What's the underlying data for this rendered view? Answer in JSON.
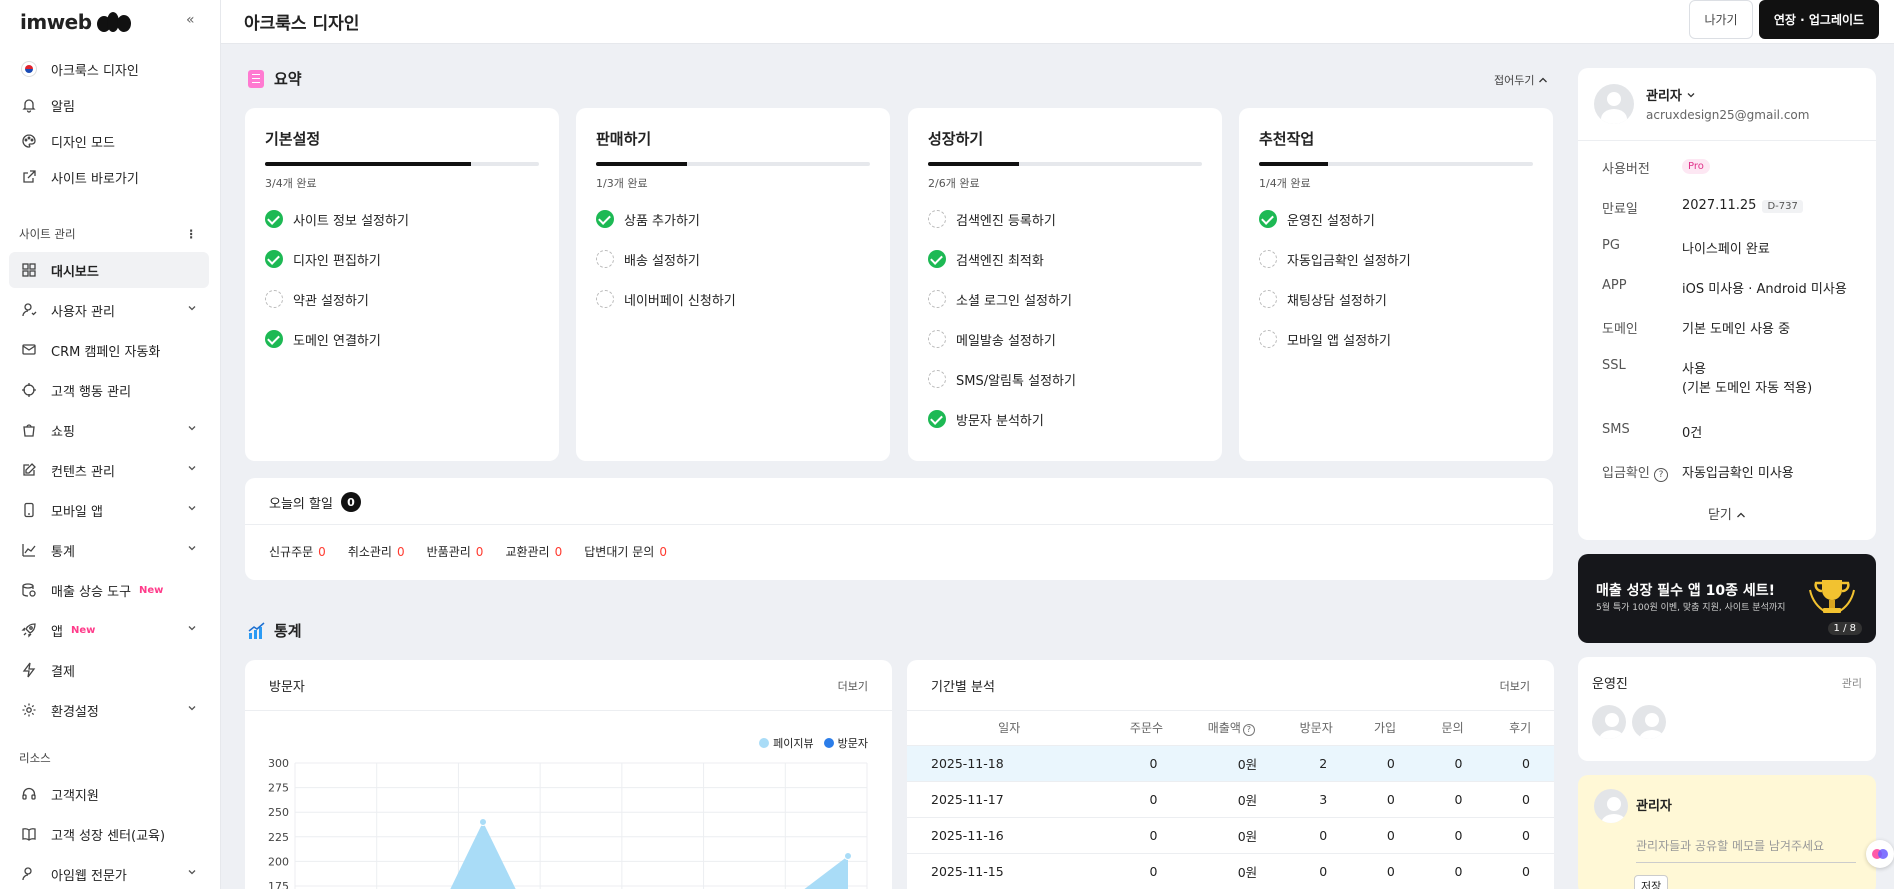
{
  "sidebar": {
    "brand": "imweb",
    "site_name": "아크룩스 디자인",
    "top_items": [
      {
        "label": "알림"
      },
      {
        "label": "디자인 모드"
      },
      {
        "label": "사이트 바로가기"
      }
    ],
    "section_manage": "사이트 관리",
    "manage_items": [
      {
        "label": "대시보드"
      },
      {
        "label": "사용자 관리"
      },
      {
        "label": "CRM 캠페인 자동화"
      },
      {
        "label": "고객 행동 관리"
      },
      {
        "label": "쇼핑"
      },
      {
        "label": "컨텐츠 관리"
      },
      {
        "label": "모바일 앱"
      },
      {
        "label": "통계"
      },
      {
        "label": "매출 상승 도구",
        "badge": "New"
      },
      {
        "label": "앱",
        "badge": "New"
      },
      {
        "label": "결제"
      },
      {
        "label": "환경설정"
      }
    ],
    "section_resources": "리소스",
    "resource_items": [
      {
        "label": "고객지원"
      },
      {
        "label": "고객 성장 센터(교육)"
      },
      {
        "label": "아임웹 전문가"
      }
    ]
  },
  "header": {
    "title": "아크룩스 디자인",
    "exit_label": "나가기",
    "upgrade_label": "연장 · 업그레이드"
  },
  "summary": {
    "title": "요약",
    "fold_label": "접어두기",
    "cards": [
      {
        "title": "기본설정",
        "progress": 0.75,
        "done": "3/4개 완료",
        "tasks": [
          {
            "label": "사이트 정보 설정하기",
            "done": true
          },
          {
            "label": "디자인 편집하기",
            "done": true
          },
          {
            "label": "약관 설정하기",
            "done": false
          },
          {
            "label": "도메인 연결하기",
            "done": true
          }
        ]
      },
      {
        "title": "판매하기",
        "progress": 0.3333,
        "done": "1/3개 완료",
        "tasks": [
          {
            "label": "상품 추가하기",
            "done": true
          },
          {
            "label": "배송 설정하기",
            "done": false
          },
          {
            "label": "네이버페이 신청하기",
            "done": false
          }
        ]
      },
      {
        "title": "성장하기",
        "progress": 0.3333,
        "done": "2/6개 완료",
        "tasks": [
          {
            "label": "검색엔진 등록하기",
            "done": false
          },
          {
            "label": "검색엔진 최적화",
            "done": true
          },
          {
            "label": "소셜 로그인 설정하기",
            "done": false
          },
          {
            "label": "메일발송 설정하기",
            "done": false
          },
          {
            "label": "SMS/알림톡 설정하기",
            "done": false
          },
          {
            "label": "방문자 분석하기",
            "done": true
          }
        ]
      },
      {
        "title": "추천작업",
        "progress": 0.25,
        "done": "1/4개 완료",
        "tasks": [
          {
            "label": "운영진 설정하기",
            "done": true
          },
          {
            "label": "자동입금확인 설정하기",
            "done": false
          },
          {
            "label": "채팅상담 설정하기",
            "done": false
          },
          {
            "label": "모바일 앱 설정하기",
            "done": false
          }
        ]
      }
    ]
  },
  "todo": {
    "title": "오늘의 할일",
    "count": "0",
    "items": [
      {
        "label": "신규주문",
        "value": "0"
      },
      {
        "label": "취소관리",
        "value": "0"
      },
      {
        "label": "반품관리",
        "value": "0"
      },
      {
        "label": "교환관리",
        "value": "0"
      },
      {
        "label": "답변대기 문의",
        "value": "0"
      }
    ]
  },
  "stats": {
    "title": "통계",
    "visitor_title": "방문자",
    "more_label": "더보기",
    "legend_pageview": "페이지뷰",
    "legend_visitor": "방문자",
    "period_title": "기간별 분석",
    "columns": [
      "일자",
      "주문수",
      "매출액",
      "방문자",
      "가입",
      "문의",
      "후기"
    ],
    "rows": [
      [
        "2025-11-18",
        "0",
        "0원",
        "2",
        "0",
        "0",
        "0"
      ],
      [
        "2025-11-17",
        "0",
        "0원",
        "3",
        "0",
        "0",
        "0"
      ],
      [
        "2025-11-16",
        "0",
        "0원",
        "0",
        "0",
        "0",
        "0"
      ],
      [
        "2025-11-15",
        "0",
        "0원",
        "0",
        "0",
        "0",
        "0"
      ]
    ]
  },
  "chart_data": {
    "type": "area",
    "ylim": [
      0,
      300
    ],
    "yticks": [
      300,
      275,
      250,
      225,
      200,
      175
    ],
    "series": [
      {
        "name": "페이지뷰",
        "color": "#a9dcf7"
      },
      {
        "name": "방문자",
        "color": "#2b7de9"
      }
    ]
  },
  "profile": {
    "name": "관리자",
    "email": "acruxdesign25@gmail.com",
    "rows": [
      {
        "k": "사용버전",
        "v": "Pro"
      },
      {
        "k": "만료일",
        "v": "2027.11.25",
        "tag": "D-737"
      },
      {
        "k": "PG",
        "v": "나이스페이 완료"
      },
      {
        "k": "APP",
        "v": "iOS 미사용 · Android 미사용"
      },
      {
        "k": "도메인",
        "v": "기본 도메인 사용 중"
      },
      {
        "k": "SSL",
        "v": "사용",
        "v2": "(기본 도메인 자동 적용)"
      },
      {
        "k": "SMS",
        "v": "0건"
      },
      {
        "k": "입금확인",
        "v": "자동입금확인 미사용"
      }
    ],
    "close_label": "닫기"
  },
  "banner": {
    "title": "매출 성장 필수 앱 10종 세트!",
    "sub": "5월 특가 100원 이벤, 맞춤 지원, 사이트 분석까지",
    "page": "1 / 8"
  },
  "operators": {
    "title": "운영진",
    "manage_label": "관리"
  },
  "memo": {
    "name": "관리자",
    "placeholder": "관리자들과 공유할 메모를 남겨주세요",
    "save_label": "저장"
  }
}
